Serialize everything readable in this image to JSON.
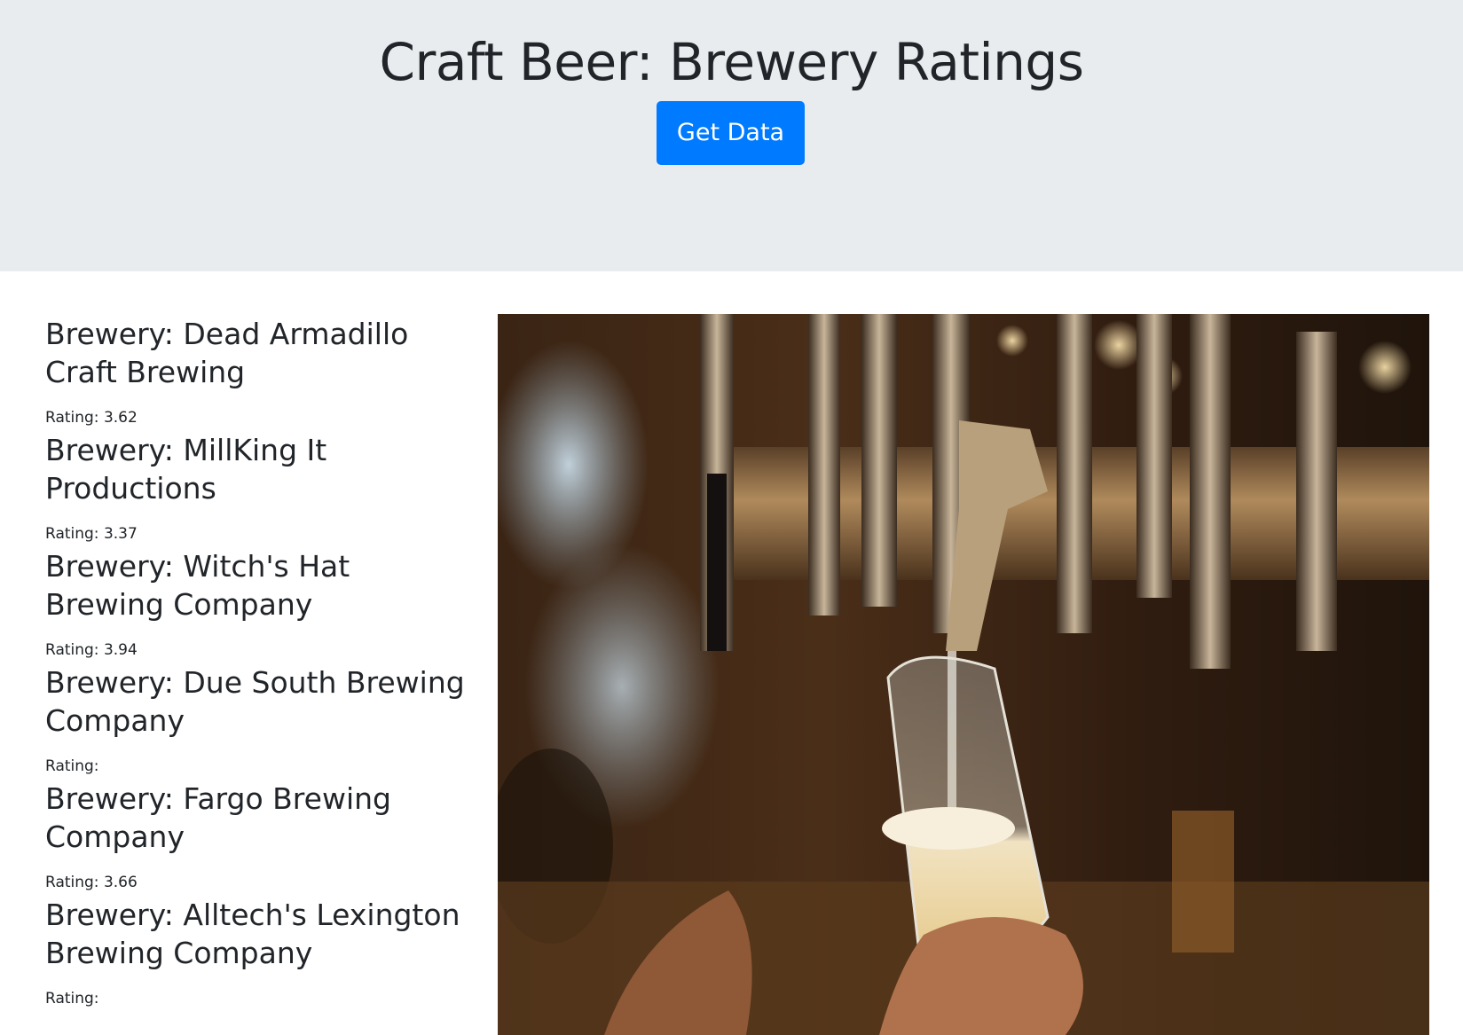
{
  "header": {
    "title": "Craft Beer: Brewery Ratings",
    "button_label": "Get Data",
    "button_color": "#007bff",
    "background": "#e9ecef"
  },
  "breweries": [
    {
      "name": "Brewery: Dead Armadillo Craft Brewing",
      "rating": "Rating: 3.62"
    },
    {
      "name": "Brewery: MillKing It Productions",
      "rating": "Rating: 3.37"
    },
    {
      "name": "Brewery: Witch's Hat Brewing Company",
      "rating": "Rating: 3.94"
    },
    {
      "name": "Brewery: Due South Brewing Company",
      "rating": "Rating:"
    },
    {
      "name": "Brewery: Fargo Brewing Company",
      "rating": "Rating: 3.66"
    },
    {
      "name": "Brewery: Alltech's Lexington Brewing Company",
      "rating": "Rating:"
    }
  ],
  "image": {
    "subject": "bartender pouring beer from taps into glass"
  }
}
